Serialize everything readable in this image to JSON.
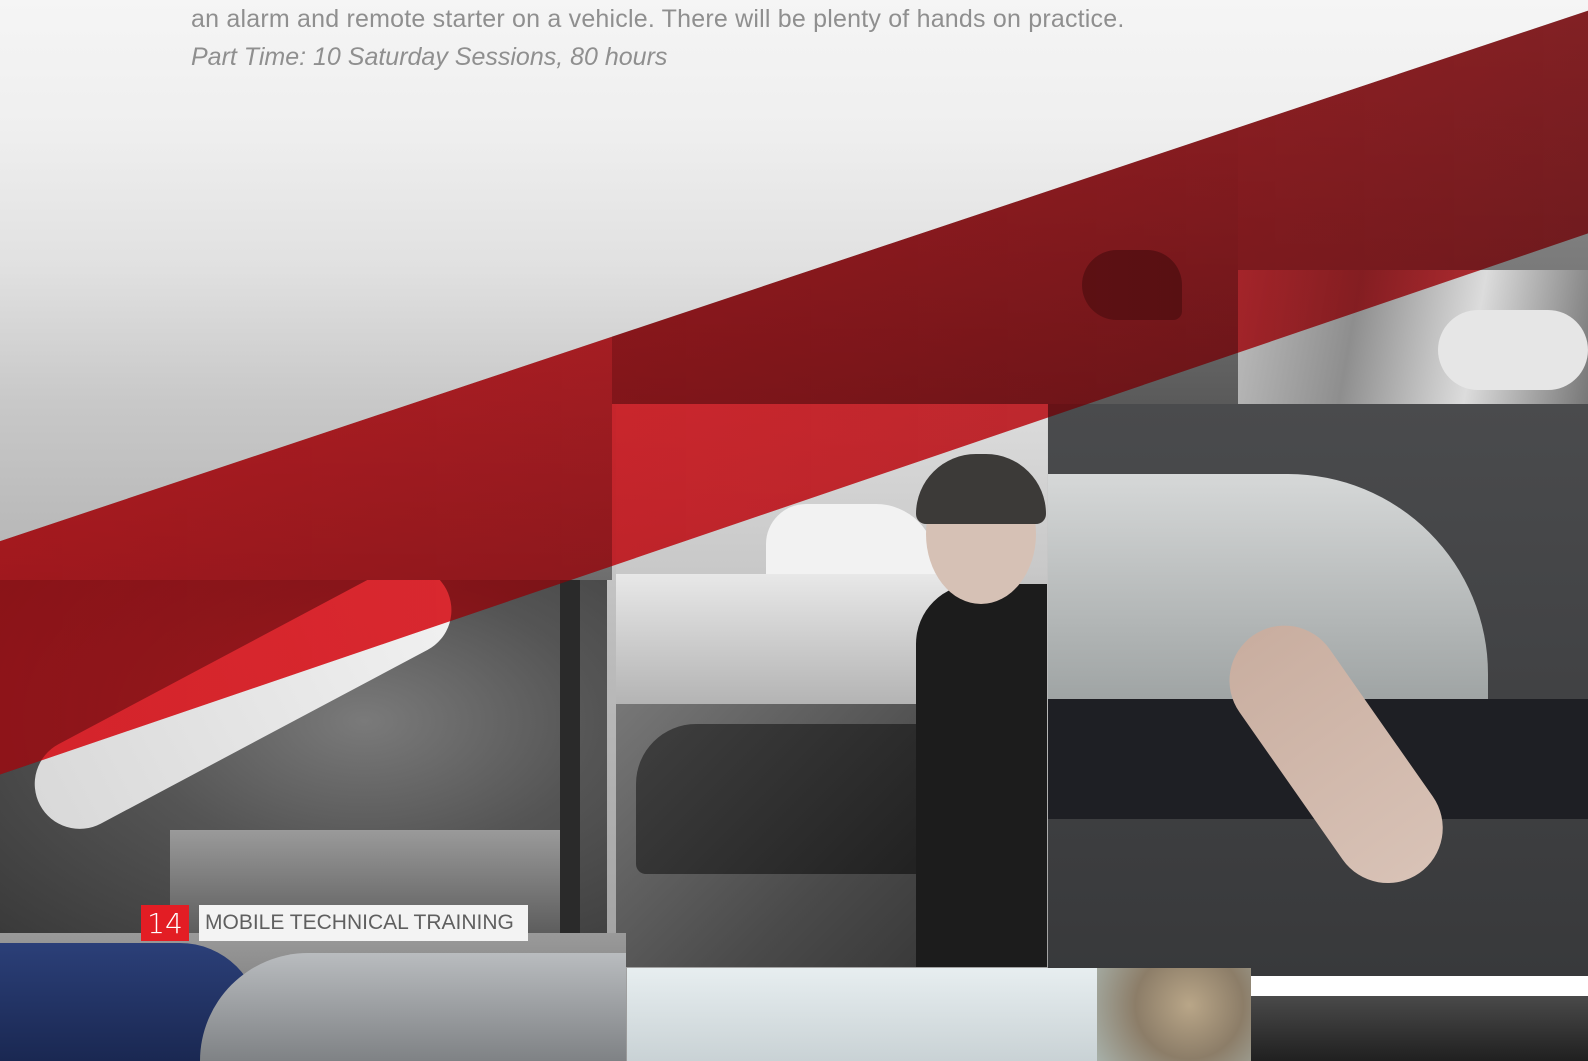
{
  "intro": {
    "line1": "an alarm and remote starter on a vehicle. There will be plenty of hands on practice.",
    "line2": "Part Time:  10 Saturday Sessions, 80 hours"
  },
  "footer": {
    "page_number": "14",
    "section_title": "MOBILE TECHNICAL TRAINING"
  },
  "colors": {
    "accent_red": "#e31d24",
    "text_gray": "#8f8f8f",
    "label_gray": "#5f5f5f"
  }
}
